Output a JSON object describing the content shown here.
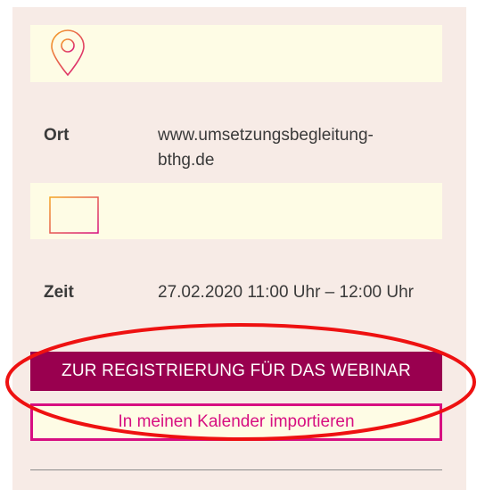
{
  "location": {
    "icon": "map-pin-icon",
    "label": "Ort",
    "value": "www.umsetzungsbegleitung-bthg.de"
  },
  "time": {
    "icon": "calendar-icon",
    "label": "Zeit",
    "value": "27.02.2020 11:00 Uhr – 12:00 Uhr"
  },
  "buttons": {
    "register_label": "ZUR REGISTRIERUNG FÜR DAS WEBINAR",
    "calendar_label": "In meinen Kalender importieren"
  },
  "colors": {
    "panel_background": "#f7ebe6",
    "icon_band_background": "#fefce5",
    "register_button": "#99004f",
    "accent_pink": "#d70f81",
    "annotation_red": "#ee1111"
  }
}
